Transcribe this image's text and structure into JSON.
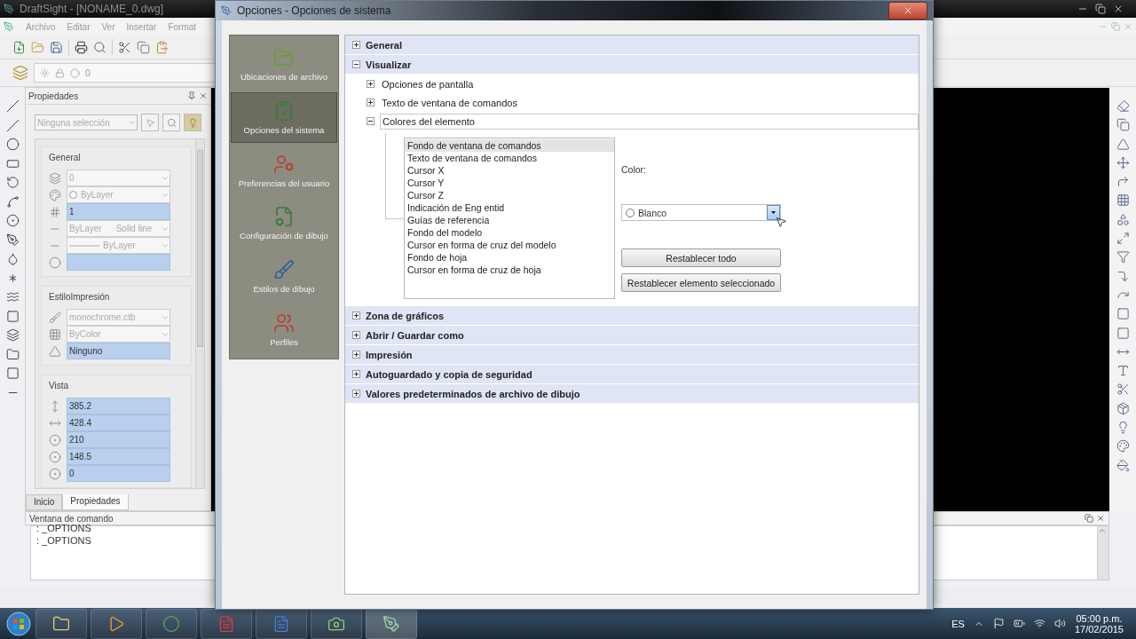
{
  "app": {
    "title": "DraftSight - [NONAME_0.dwg]",
    "menu": [
      "Archivo",
      "Editar",
      "Ver",
      "Insertar",
      "Format"
    ],
    "layer": "0"
  },
  "properties": {
    "title": "Propiedades",
    "selection": "Ninguna selección",
    "sections": [
      {
        "title": "General",
        "fields": [
          {
            "kind": "dropdown",
            "value": "0",
            "disabled": true
          },
          {
            "kind": "color_dropdown",
            "value": "ByLayer",
            "disabled": true
          },
          {
            "kind": "input",
            "value": "1",
            "disabled": false
          },
          {
            "kind": "dropdown",
            "value": "ByLayer",
            "detail": "Solid line",
            "disabled": true
          },
          {
            "kind": "line_dropdown",
            "value": "ByLayer",
            "disabled": true
          },
          {
            "kind": "input",
            "disabled": false
          }
        ]
      },
      {
        "title": "EstiloImpresión",
        "fields": [
          {
            "kind": "dropdown",
            "value": "monochrome.ctb",
            "disabled": true
          },
          {
            "kind": "dropdown",
            "value": "ByColor",
            "disabled": true
          },
          {
            "kind": "input",
            "value": "Ninguno",
            "disabled": false
          }
        ]
      },
      {
        "title": "Vista",
        "fields": [
          {
            "kind": "input",
            "value": "385.2",
            "disabled": false
          },
          {
            "kind": "input",
            "value": "428.4",
            "disabled": false
          },
          {
            "kind": "input",
            "value": "210",
            "disabled": false
          },
          {
            "kind": "input",
            "value": "148.5",
            "disabled": false
          },
          {
            "kind": "input",
            "value": "0",
            "disabled": false
          }
        ]
      }
    ]
  },
  "tabs": [
    {
      "label": "Inicio",
      "selected": false
    },
    {
      "label": "Propiedades",
      "selected": true
    }
  ],
  "command_window": {
    "title": "Ventana de comando",
    "lines": [
      ": _OPTIONS",
      ": _OPTIONS"
    ]
  },
  "dialog": {
    "title": "Opciones - Opciones de sistema",
    "sidebar": [
      {
        "label": "Ubicaciones de archivo",
        "selected": false
      },
      {
        "label": "Opciones del sistema",
        "selected": true
      },
      {
        "label": "Preferencias del usuario",
        "selected": false
      },
      {
        "label": "Configuración de dibujo",
        "selected": false
      },
      {
        "label": "Estilos de dibujo",
        "selected": false
      },
      {
        "label": "Perfiles",
        "selected": false
      }
    ],
    "tree": [
      {
        "label": "General",
        "expanded": false
      },
      {
        "label": "Visualizar",
        "expanded": true,
        "children": [
          {
            "label": "Opciones de pantalla",
            "expanded": false
          },
          {
            "label": "Texto de ventana de comandos",
            "expanded": false
          },
          {
            "label": "Colores del elemento",
            "expanded": true,
            "panel": {
              "elements": [
                {
                  "label": "Fondo de ventana de comandos",
                  "selected": true
                },
                {
                  "label": "Texto de ventana de comandos",
                  "selected": false
                },
                {
                  "label": "Cursor X",
                  "selected": false
                },
                {
                  "label": "Cursor Y",
                  "selected": false
                },
                {
                  "label": "Cursor Z",
                  "selected": false
                },
                {
                  "label": "Indicación de Eng entid",
                  "selected": false
                },
                {
                  "label": "Guías de referencia",
                  "selected": false
                },
                {
                  "label": "Fondo del modelo",
                  "selected": false
                },
                {
                  "label": "Cursor en forma de cruz del modelo",
                  "selected": false
                },
                {
                  "label": "Fondo de hoja",
                  "selected": false
                },
                {
                  "label": "Cursor en forma de cruz de hoja",
                  "selected": false
                }
              ],
              "color_label": "Color:",
              "color": {
                "value": "Blanco"
              },
              "buttons": [
                "Restablecer todo",
                "Restablecer elemento seleccionado"
              ]
            }
          }
        ]
      },
      {
        "label": "Zona de gráficos",
        "expanded": false
      },
      {
        "label": "Abrir / Guardar como",
        "expanded": false
      },
      {
        "label": "Impresión",
        "expanded": false
      },
      {
        "label": "Autoguardado y copia de seguridad",
        "expanded": false
      },
      {
        "label": "Valores predeterminados de archivo de dibujo",
        "expanded": false
      }
    ]
  },
  "taskbar": {
    "language": "ES",
    "time": "05:00 p.m.",
    "date": "17/02/2015"
  }
}
